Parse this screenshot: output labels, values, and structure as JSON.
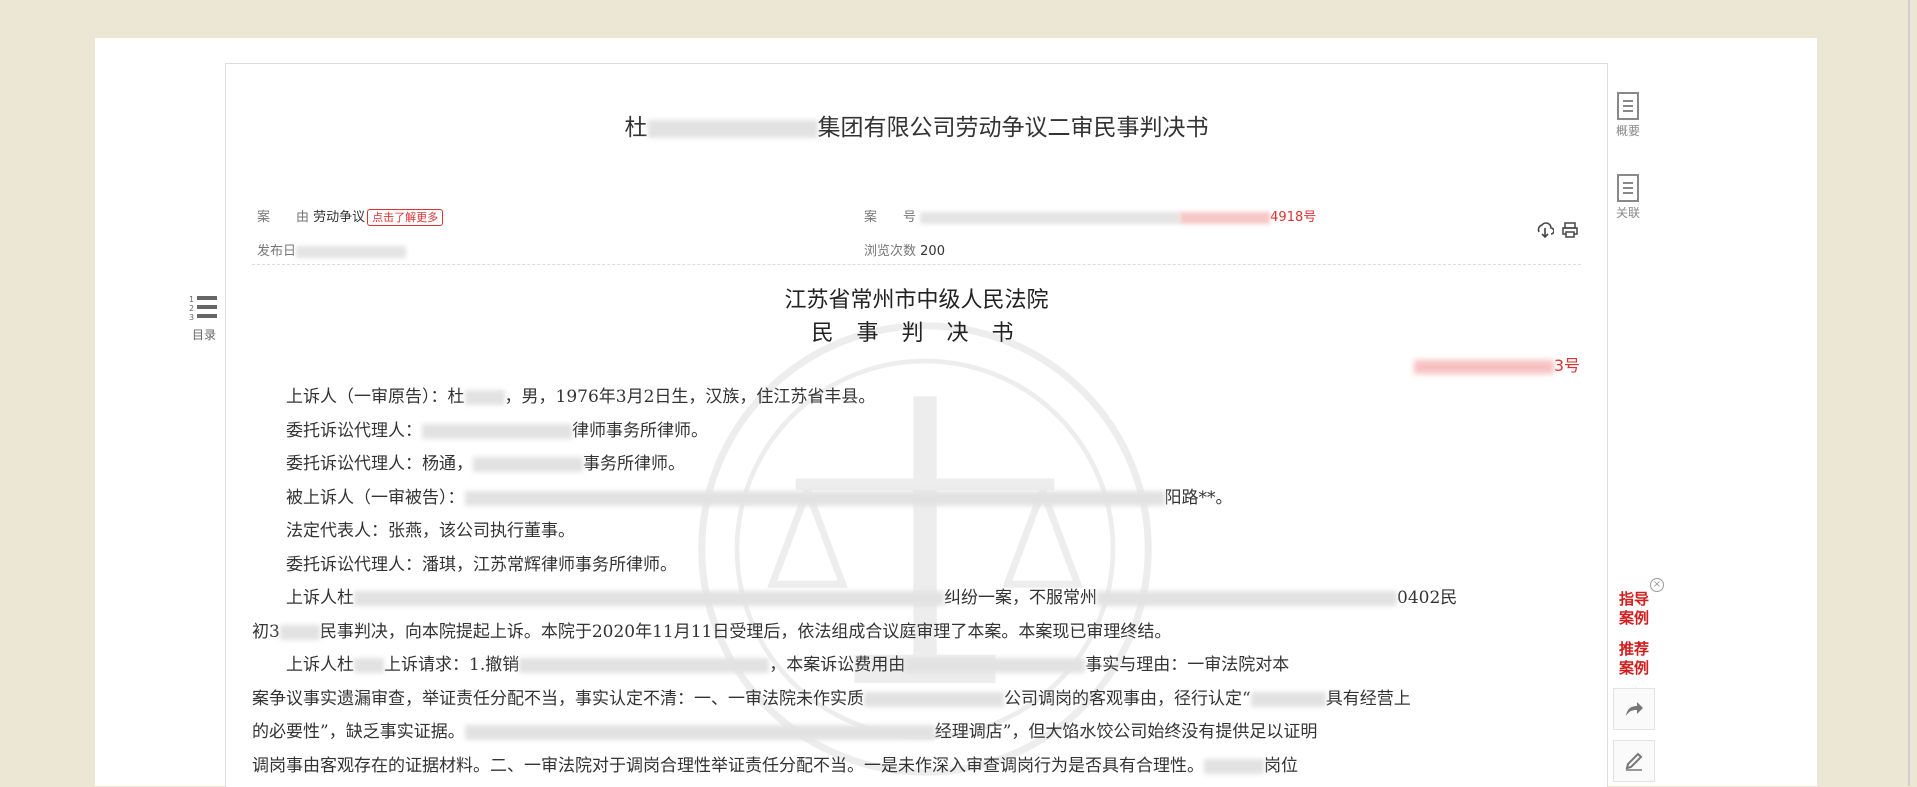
{
  "document": {
    "title_visible_start": "杜",
    "title_visible_end": "集团有限公司劳动争议二审民事判决书"
  },
  "meta": {
    "cause_label": "案　　由",
    "cause_value": "劳动争议",
    "learn_more": "点击了解更多",
    "case_no_label": "案　　号",
    "case_no_suffix": "4918号",
    "publish_label": "发布日",
    "views_label": "浏览次数",
    "views_value": "200"
  },
  "court": {
    "name": "江苏省常州市中级人民法院",
    "doc_kind": "民 事 判 决 书",
    "ref_suffix": "3号"
  },
  "parties": {
    "appellant_a": "上诉人（一审原告）：杜",
    "appellant_b": "，男，1976年3月2日生，汉族，住江苏省丰县。",
    "agent1_a": "委托诉讼代理人：",
    "agent1_b": "律师事务所律师。",
    "agent2_a": "委托诉讼代理人：杨通，",
    "agent2_b": "事务所律师。",
    "appellee_a": "被上诉人（一审被告）：",
    "appellee_b": "阳路**。",
    "legal_rep": "法定代表人：张燕，该公司执行董事。",
    "agent3": "委托诉讼代理人：潘琪，江苏常辉律师事务所律师。"
  },
  "paragraphs": {
    "p1_a": "上诉人杜",
    "p1_b": "纠纷一案，不服常州",
    "p1_c": "0402民",
    "p1_line2": "初3",
    "p1_line2_b": "民事判决，向本院提起上诉。本院于2020年11月11日受理后，依法组成合议庭审理了本案。本案现已审理终结。",
    "p2_a": "上诉人杜",
    "p2_b": "上诉请求：1.撤销",
    "p2_c": "，本案诉讼费用由",
    "p2_d": "事实与理由：一审法院对本",
    "p2_line2": "案争议事实遗漏审查，举证责任分配不当，事实认定不清：一、一审法院未作实质",
    "p2_line2_b": "公司调岗的客观事由，径行认定“",
    "p2_line2_c": "具有经营上",
    "p2_line3": "的必要性”，缺乏事实证据。",
    "p2_line3_b": "经理调店”，但大馅水饺公司始终没有提供足以证明",
    "p2_line4": "调岗事由客观存在的证据材料。二、一审法院对于调岗合理性举证责任分配不当。一是未作深入审查调岗行为是否具有合理性。",
    "p2_line4_b": "岗位"
  },
  "toc": {
    "label": "目录",
    "nums": "1 2 3"
  },
  "side": {
    "summary": "概要",
    "related": "关联",
    "guide_case": "指导\n案例",
    "recommend_case": "推荐\n案例"
  }
}
